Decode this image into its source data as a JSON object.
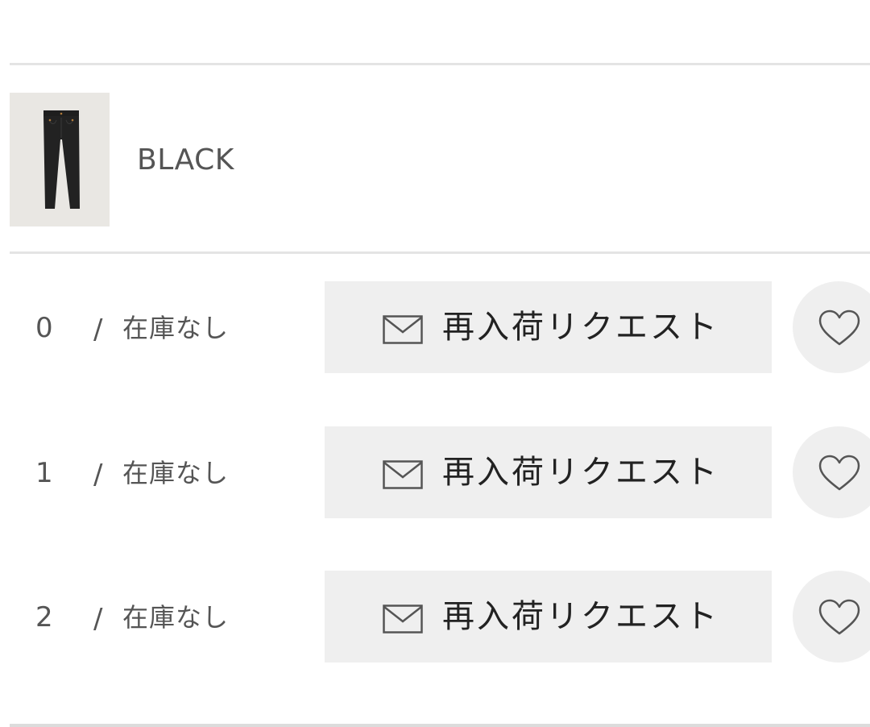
{
  "color": {
    "name": "BLACK",
    "thumbnail_icon": "jeans-product-image"
  },
  "sizes": [
    {
      "size": "0",
      "separator": "/",
      "stock_status": "在庫なし",
      "request_label": "再入荷リクエスト"
    },
    {
      "size": "1",
      "separator": "/",
      "stock_status": "在庫なし",
      "request_label": "再入荷リクエスト"
    },
    {
      "size": "2",
      "separator": "/",
      "stock_status": "在庫なし",
      "request_label": "再入荷リクエスト"
    }
  ],
  "icons": {
    "request": "mail-icon",
    "favorite": "heart-icon"
  },
  "colors": {
    "divider": "#e4e4e4",
    "button_bg": "#efefef",
    "text": "#555555",
    "button_text": "#222222",
    "thumb_bg": "#e9e7e3"
  }
}
